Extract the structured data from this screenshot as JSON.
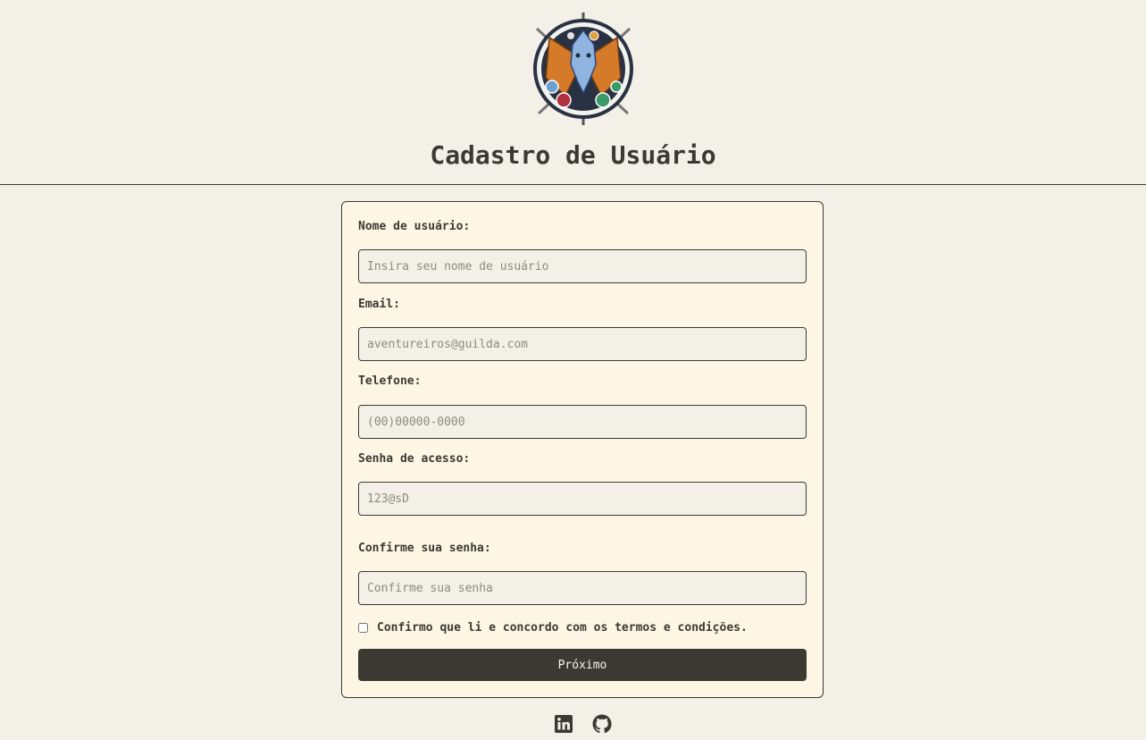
{
  "header": {
    "logo": "dragon-guild-emblem",
    "title": "Cadastro de Usuário"
  },
  "form": {
    "username": {
      "label": "Nome de usuário:",
      "placeholder": "Insira seu nome de usuário",
      "value": ""
    },
    "email": {
      "label": "Email:",
      "placeholder": "aventureiros@guilda.com",
      "value": ""
    },
    "phone": {
      "label": "Telefone:",
      "placeholder": "(00)00000-0000",
      "value": ""
    },
    "password": {
      "label": "Senha de acesso:",
      "placeholder": "123@sD",
      "value": ""
    },
    "confirm_password": {
      "label": "Confirme sua senha:",
      "placeholder": "Confirme sua senha",
      "value": ""
    },
    "terms": {
      "label": "Confirmo que li e concordo com os termos e condições.",
      "checked": false
    },
    "submit_label": "Próximo"
  },
  "footer": {
    "icons": [
      "linkedin-icon",
      "github-icon"
    ]
  },
  "colors": {
    "background": "#f3f0e8",
    "card": "#fdf6e4",
    "ink": "#3a3a33"
  }
}
